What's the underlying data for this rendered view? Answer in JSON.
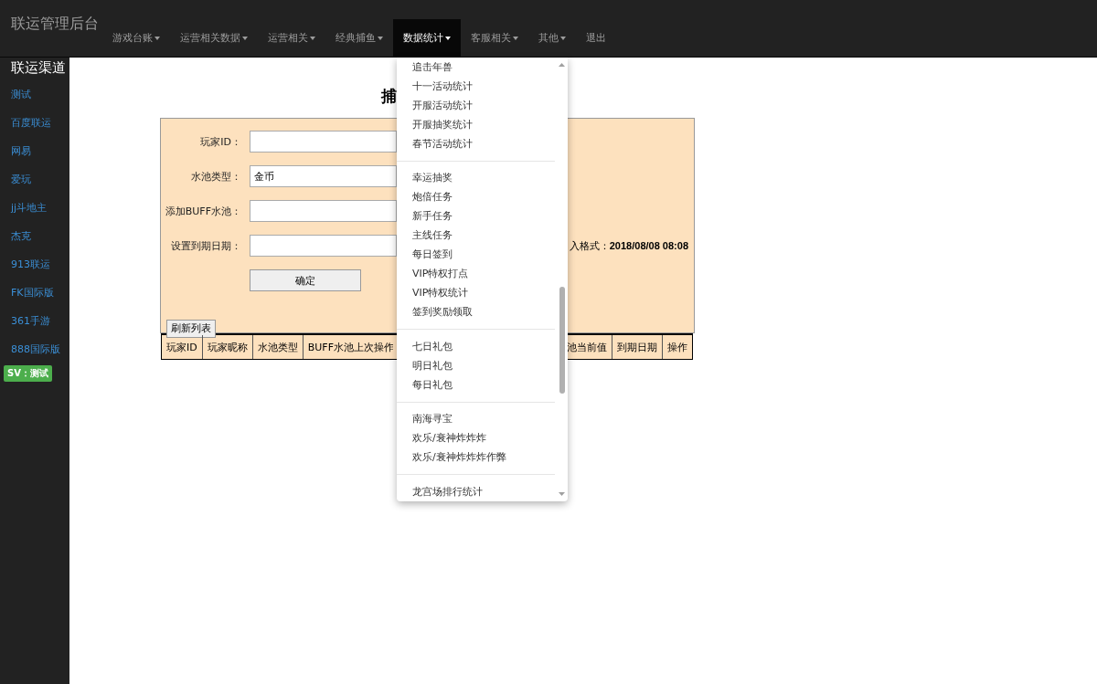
{
  "brand": "联运管理后台",
  "nav": [
    {
      "label": "游戏台账",
      "caret": true,
      "selected": false
    },
    {
      "label": "运营相关数据",
      "caret": true,
      "selected": false
    },
    {
      "label": "运营相关",
      "caret": true,
      "selected": false
    },
    {
      "label": "经典捕鱼",
      "caret": true,
      "selected": false
    },
    {
      "label": "数据统计",
      "caret": true,
      "selected": true
    },
    {
      "label": "客服相关",
      "caret": true,
      "selected": false
    },
    {
      "label": "其他",
      "caret": true,
      "selected": false
    },
    {
      "label": "退出",
      "caret": false,
      "selected": false
    }
  ],
  "sidebar": {
    "title": "联运渠道",
    "items": [
      "测试",
      "百度联运",
      "网易",
      "爱玩",
      "jj斗地主",
      "杰克",
      "913联运",
      "FK国际版",
      "361手游",
      "888国际版"
    ],
    "badge": "SV：测试"
  },
  "page_title": "捕",
  "form": {
    "fields": [
      {
        "label": "玩家ID："
      },
      {
        "label": "水池类型：",
        "value": "金币"
      },
      {
        "label": "添加BUFF水池："
      },
      {
        "label": "设置到期日期：",
        "hint": "入格式：**2018/08/08 08:08**"
      }
    ],
    "submit": "确定",
    "refresh": "刷新列表"
  },
  "table": {
    "columns": [
      "玩家ID",
      "玩家昵称",
      "水池类型",
      "BUFF水池上次操作",
      "池当前值",
      "到期日期",
      "操作"
    ]
  },
  "dropdown": {
    "sections": [
      [
        "追击年兽",
        "十一活动统计",
        "开服活动统计",
        "开服抽奖统计",
        "春节活动统计"
      ],
      [
        "幸运抽奖",
        "炮倍任务",
        "新手任务",
        "主线任务",
        "每日签到",
        "VIP特权打点",
        "VIP特权统计",
        "签到奖励领取"
      ],
      [
        "七日礼包",
        "明日礼包",
        "每日礼包"
      ],
      [
        "南海寻宝",
        "欢乐/衰神炸炸炸",
        "欢乐/衰神炸炸炸作弊"
      ],
      [
        "龙宫场排行统计"
      ]
    ]
  }
}
